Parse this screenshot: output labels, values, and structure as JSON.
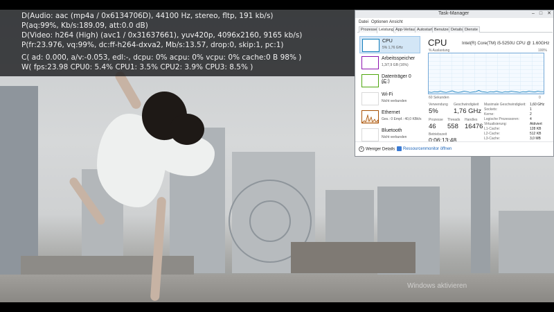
{
  "osd": {
    "lines": [
      "D(Audio: aac (mp4a / 0x6134706D), 44100 Hz, stereo, fltp, 191 kb/s)",
      "P(aq:99%, Kb/s:189.09, att:0.0 dB)",
      "D(Video: h264 (High) (avc1 / 0x31637661), yuv420p, 4096x2160, 9165 kb/s)",
      "P(fr:23.976, vq:99%, dc:ff-h264-dxva2, Mb/s:13.57, drop:0, skip:1, pc:1)",
      "C( ad: 0.000, a/v:-0.053, edl:-, dcpu: 0% acpu: 0% vcpu: 0% cache:0  B  98% )",
      "W( fps:23.98 CPU0: 5.4% CPU1: 3.5% CPU2: 3.9% CPU3: 8.5% )"
    ]
  },
  "watermark": "Windows aktivieren",
  "taskmanager": {
    "title": "Task-Manager",
    "buttons": {
      "minimize": "–",
      "maximize": "□",
      "close": "✕"
    },
    "menu": [
      "Datei",
      "Optionen",
      "Ansicht"
    ],
    "tabs": [
      "Prozesse",
      "Leistung",
      "App-Verlauf",
      "Autostart",
      "Benutzer",
      "Details",
      "Dienste"
    ],
    "active_tab": "Leistung",
    "resources": [
      {
        "name": "CPU",
        "sub": "5% 1,76 GHz",
        "color": "#117dbb"
      },
      {
        "name": "Arbeitsspeicher",
        "sub": "1,3/7,9 GB (16%)",
        "color": "#8b12ae"
      },
      {
        "name": "Datenträger 0 (C:)",
        "sub": "0%",
        "color": "#4da60c"
      },
      {
        "name": "Wi-Fi",
        "sub": "Nicht verbunden",
        "color": "#a74f01"
      },
      {
        "name": "Ethernet",
        "sub": "Ges.: 0 Empf.: 40,0 KBit/s",
        "color": "#a74f01"
      },
      {
        "name": "Bluetooth",
        "sub": "Nicht verbunden",
        "color": "#a74f01"
      }
    ],
    "cpu": {
      "heading": "CPU",
      "model": "Intel(R) Core(TM) i5-5250U CPU @ 1.60GHz",
      "util_label": "% Auslastung",
      "util_max": "100%",
      "time_label": "60 Sekunden",
      "zero_label": "0",
      "graph_history": [
        4,
        3,
        5,
        4,
        6,
        4,
        3,
        5,
        7,
        4,
        3,
        4,
        6,
        5,
        3,
        4,
        5,
        8,
        5,
        4,
        3,
        5,
        4,
        6,
        4,
        3,
        5,
        4,
        6,
        5,
        4,
        3,
        5,
        4,
        6,
        5,
        4,
        6,
        5,
        5
      ],
      "stats": {
        "usage_label": "Verwendung",
        "usage": "5%",
        "speed_label": "Geschwindigkeit",
        "speed": "1,76 GHz",
        "processes_label": "Prozesse",
        "processes": "46",
        "threads_label": "Threads",
        "threads": "558",
        "handles_label": "Handles",
        "handles": "16476",
        "uptime_label": "Betriebszeit",
        "uptime": "0:06:13:48"
      },
      "details": [
        {
          "key": "Maximale Geschwindigkeit:",
          "value": "1,60 GHz"
        },
        {
          "key": "Sockets:",
          "value": "1"
        },
        {
          "key": "Kerne:",
          "value": "2"
        },
        {
          "key": "Logische Prozessoren:",
          "value": "4"
        },
        {
          "key": "Virtualisierung:",
          "value": "Aktiviert"
        },
        {
          "key": "L1-Cache:",
          "value": "128 KB"
        },
        {
          "key": "L2-Cache:",
          "value": "512 KB"
        },
        {
          "key": "L3-Cache:",
          "value": "3,0 MB"
        }
      ]
    },
    "footer": {
      "fewer_details": "Weniger Details",
      "resmon": "Ressourcenmonitor öffnen"
    }
  }
}
